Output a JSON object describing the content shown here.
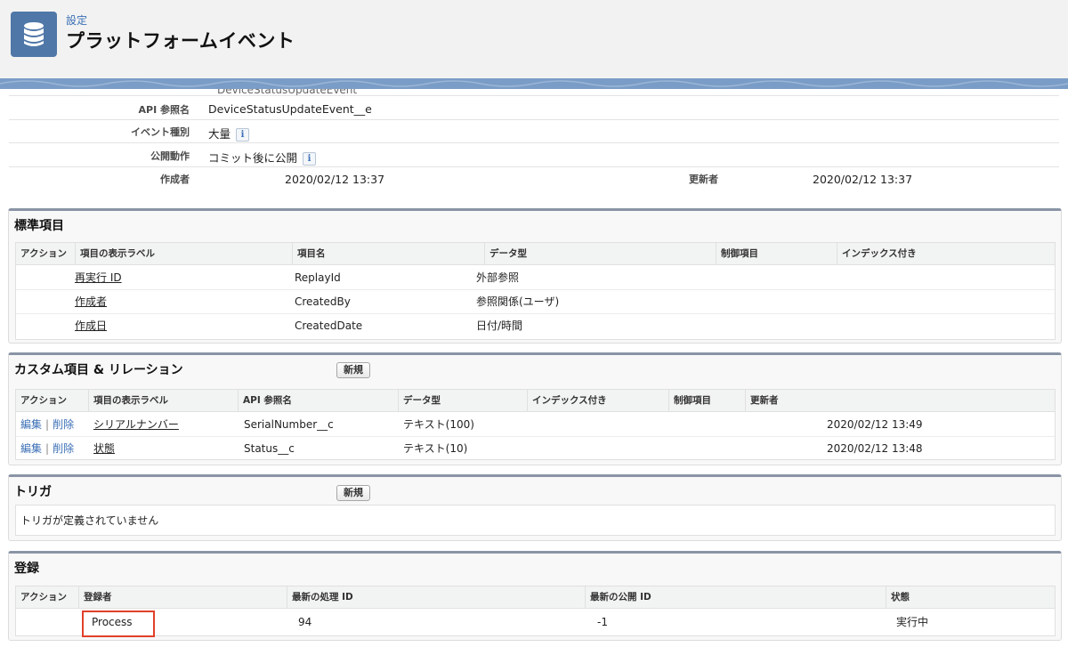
{
  "header": {
    "breadcrumb": "設定",
    "title": "プラットフォームイベント",
    "icon": "database-icon",
    "icon_color": "#4f77a8"
  },
  "details": {
    "cut_value": "DeviceStatusUpdateEvent",
    "api_name_label": "API 参照名",
    "api_name_value": "DeviceStatusUpdateEvent__e",
    "event_type_label": "イベント種別",
    "event_type_value": "大量",
    "publish_behavior_label": "公開動作",
    "publish_behavior_value": "コミット後に公開",
    "info_glyph": "i",
    "created_by_label": "作成者",
    "created_by_value": "2020/02/12 13:37",
    "modified_by_label": "更新者",
    "modified_by_value": "2020/02/12 13:37"
  },
  "standard_fields": {
    "title": "標準項目",
    "columns": [
      "アクション",
      "項目の表示ラベル",
      "項目名",
      "データ型",
      "制御項目",
      "インデックス付き"
    ],
    "rows": [
      {
        "label": "再実行 ID",
        "name": "ReplayId",
        "type": "外部参照"
      },
      {
        "label": "作成者",
        "name": "CreatedBy",
        "type": "参照関係(ユーザ)"
      },
      {
        "label": "作成日",
        "name": "CreatedDate",
        "type": "日付/時間"
      }
    ]
  },
  "custom_fields": {
    "title": "カスタム項目 & リレーション",
    "new_button": "新規",
    "columns": [
      "アクション",
      "項目の表示ラベル",
      "API 参照名",
      "データ型",
      "インデックス付き",
      "制御項目",
      "更新者"
    ],
    "edit_label": "編集",
    "delete_label": "削除",
    "separator": "|",
    "rows": [
      {
        "label": "シリアルナンバー",
        "api": "SerialNumber__c",
        "type": "テキスト(100)",
        "modified": "2020/02/12 13:49"
      },
      {
        "label": "状態",
        "api": "Status__c",
        "type": "テキスト(10)",
        "modified": "2020/02/12 13:48"
      }
    ]
  },
  "triggers": {
    "title": "トリガ",
    "new_button": "新規",
    "empty_message": "トリガが定義されていません"
  },
  "subscriptions": {
    "title": "登録",
    "columns": [
      "アクション",
      "登録者",
      "最新の処理 ID",
      "最新の公開 ID",
      "状態"
    ],
    "rows": [
      {
        "subscriber": "Process",
        "last_processed": "94",
        "last_published": "-1",
        "status": "実行中"
      }
    ]
  },
  "colors": {
    "accent": "#3b6fb6",
    "highlight": "#e0402a",
    "band": "#7a9dc7"
  }
}
